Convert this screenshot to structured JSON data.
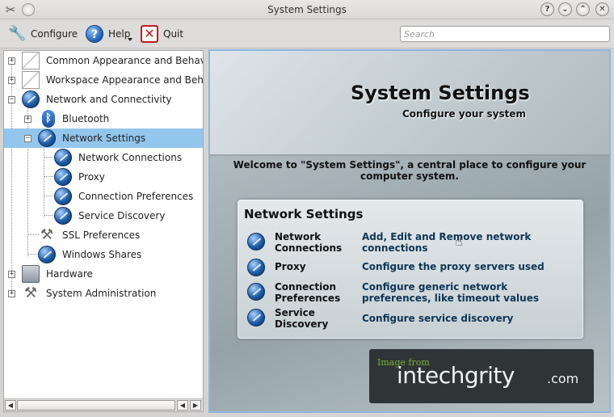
{
  "window": {
    "title": "System Settings",
    "buttons": [
      "?",
      "⌄",
      "⌃",
      "✕"
    ]
  },
  "toolbar": {
    "configure_label": "Configure",
    "help_label": "Help",
    "quit_label": "Quit",
    "search_placeholder": "Search"
  },
  "tree": {
    "items": [
      {
        "label": "Common Appearance and Behavior",
        "expander": "+",
        "icon": "appearance-icon",
        "level": 0
      },
      {
        "label": "Workspace Appearance and Behavior",
        "expander": "+",
        "icon": "workspace-icon",
        "level": 0
      },
      {
        "label": "Network and Connectivity",
        "expander": "−",
        "icon": "globe-icon",
        "level": 0
      },
      {
        "label": "Bluetooth",
        "expander": "+",
        "icon": "bluetooth-icon",
        "level": 1
      },
      {
        "label": "Network Settings",
        "expander": "−",
        "icon": "globe-icon",
        "level": 1,
        "selected": true
      },
      {
        "label": "Network Connections",
        "icon": "globe-icon",
        "level": 2
      },
      {
        "label": "Proxy",
        "icon": "globe-icon",
        "level": 2
      },
      {
        "label": "Connection Preferences",
        "icon": "globe-icon",
        "level": 2
      },
      {
        "label": "Service Discovery",
        "icon": "globe-icon",
        "level": 2
      },
      {
        "label": "SSL Preferences",
        "icon": "tools-icon",
        "level": 1
      },
      {
        "label": "Windows Shares",
        "icon": "globe-icon",
        "level": 1
      },
      {
        "label": "Hardware",
        "expander": "+",
        "icon": "hardware-icon",
        "level": 0
      },
      {
        "label": "System Administration",
        "expander": "+",
        "icon": "tools-icon",
        "level": 0
      }
    ]
  },
  "content": {
    "title": "System Settings",
    "subtitle": "Configure your system",
    "welcome": "Welcome to \"System Settings\", a central place to configure your computer system.",
    "card": {
      "title": "Network Settings",
      "items": [
        {
          "name": "Network Connections",
          "description": "Add, Edit and Remove network connections"
        },
        {
          "name": "Proxy",
          "description": "Configure the proxy servers used"
        },
        {
          "name": "Connection Preferences",
          "description": "Configure generic network preferences, like timeout values"
        },
        {
          "name": "Service Discovery",
          "description": "Configure service discovery"
        }
      ]
    }
  },
  "watermark": {
    "small": "Image from",
    "big": "intechgrity",
    "suffix": ".com"
  },
  "colors": {
    "selection": "#93c6ed",
    "link_text": "#0f3555",
    "content_border": "#8fb6e0"
  }
}
